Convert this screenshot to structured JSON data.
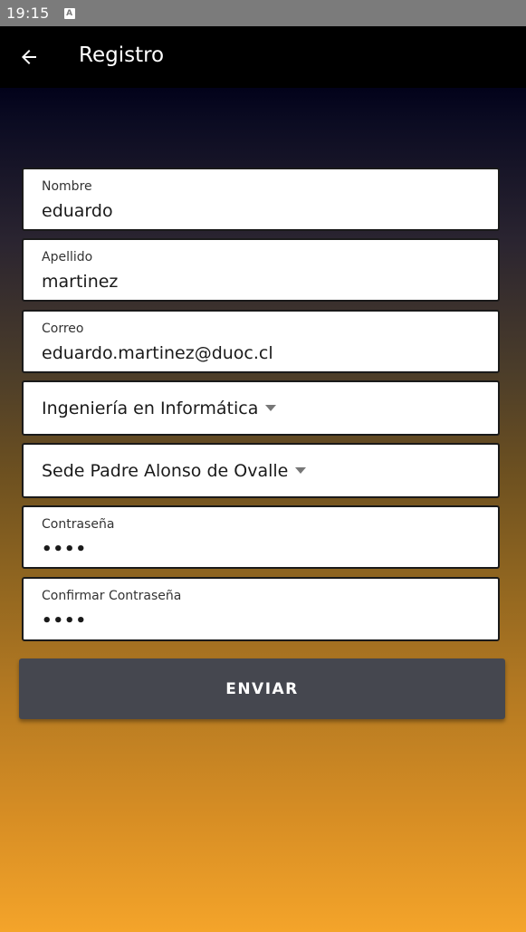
{
  "status_bar": {
    "time": "19:15",
    "notification_icon": "A"
  },
  "app_bar": {
    "back_icon": "arrow-left-icon",
    "title": "Registro"
  },
  "form": {
    "nombre": {
      "label": "Nombre",
      "value": "eduardo"
    },
    "apellido": {
      "label": "Apellido",
      "value": "martinez"
    },
    "correo": {
      "label": "Correo",
      "value": "eduardo.martinez@duoc.cl"
    },
    "carrera": {
      "selected": "Ingeniería en Informática"
    },
    "sede": {
      "selected": "Sede Padre Alonso de Ovalle"
    },
    "contrasena": {
      "label": "Contraseña",
      "value": "••••"
    },
    "confirmar_contrasena": {
      "label": "Confirmar Contraseña",
      "value": "••••"
    },
    "submit_label": "ENVIAR"
  },
  "colors": {
    "app_bar": "#000000",
    "status_bar": "#7b7b7b",
    "button": "#45474f",
    "gradient_top": "#02021a",
    "gradient_bottom": "#f4a42a"
  }
}
